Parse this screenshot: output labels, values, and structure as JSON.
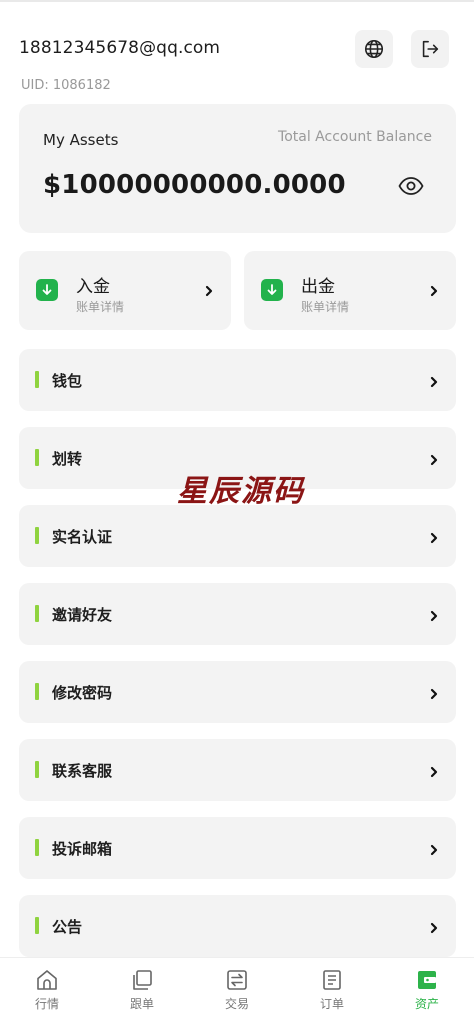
{
  "header": {
    "email": "18812345678@qq.com",
    "uid": "UID: 1086182",
    "globe_icon": "globe-icon",
    "logout_icon": "logout-icon"
  },
  "assets": {
    "title": "My Assets",
    "balance_label": "Total Account Balance",
    "balance_value": "$10000000000.0000",
    "eye_icon": "eye-icon"
  },
  "quick_actions": [
    {
      "title": "入金",
      "subtitle": "账单详情",
      "icon": "arrow-down-icon"
    },
    {
      "title": "出金",
      "subtitle": "账单详情",
      "icon": "arrow-down-icon"
    }
  ],
  "menu": [
    {
      "label": "钱包"
    },
    {
      "label": "划转"
    },
    {
      "label": "实名认证"
    },
    {
      "label": "邀请好友"
    },
    {
      "label": "修改密码"
    },
    {
      "label": "联系客服"
    },
    {
      "label": "投诉邮箱"
    },
    {
      "label": "公告"
    }
  ],
  "watermark": "星辰源码",
  "tabs": [
    {
      "label": "行情",
      "icon": "home-icon",
      "active": false
    },
    {
      "label": "跟单",
      "icon": "copy-icon",
      "active": false
    },
    {
      "label": "交易",
      "icon": "exchange-icon",
      "active": false
    },
    {
      "label": "订单",
      "icon": "orders-icon",
      "active": false
    },
    {
      "label": "资产",
      "icon": "wallet-icon",
      "active": true
    }
  ],
  "colors": {
    "accent_green": "#2db34a",
    "menu_bar": "#8fd33f",
    "card_bg": "#f3f3f3",
    "watermark": "#8b1515"
  }
}
